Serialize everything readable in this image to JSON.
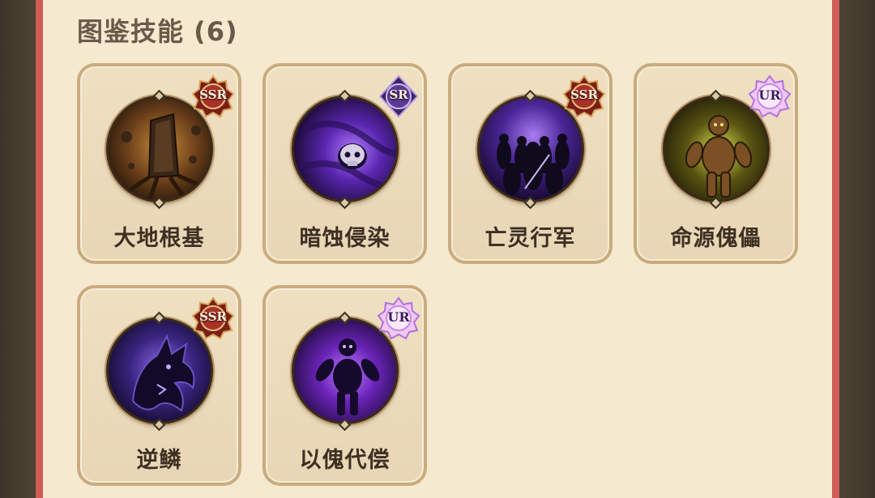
{
  "section": {
    "title": "图鉴技能 (6)"
  },
  "skills": [
    {
      "name": "大地根基",
      "rarity": "SSR",
      "theme": "earth-pillar-icon",
      "colors": {
        "bg": "#3b2312",
        "glow": "#c68a3a"
      }
    },
    {
      "name": "暗蚀侵染",
      "rarity": "SR",
      "theme": "shadow-skull-icon",
      "colors": {
        "bg": "#24104a",
        "glow": "#9b5cf0"
      }
    },
    {
      "name": "亡灵行军",
      "rarity": "SSR",
      "theme": "undead-army-icon",
      "colors": {
        "bg": "#1b0f38",
        "glow": "#8c5ce0"
      }
    },
    {
      "name": "命源傀儡",
      "rarity": "UR",
      "theme": "golem-puppet-icon",
      "colors": {
        "bg": "#2c2a0c",
        "glow": "#c5d23a"
      }
    },
    {
      "name": "逆鳞",
      "rarity": "SSR",
      "theme": "dragon-head-icon",
      "colors": {
        "bg": "#1a1238",
        "glow": "#7a54d6"
      }
    },
    {
      "name": "以傀代偿",
      "rarity": "UR",
      "theme": "shadow-puppet-icon",
      "colors": {
        "bg": "#200b3a",
        "glow": "#a35af0"
      }
    }
  ],
  "rarity_colors": {
    "SSR": "#a8322a",
    "SR": "#5a3a92",
    "UR": "#d8b6f0"
  }
}
